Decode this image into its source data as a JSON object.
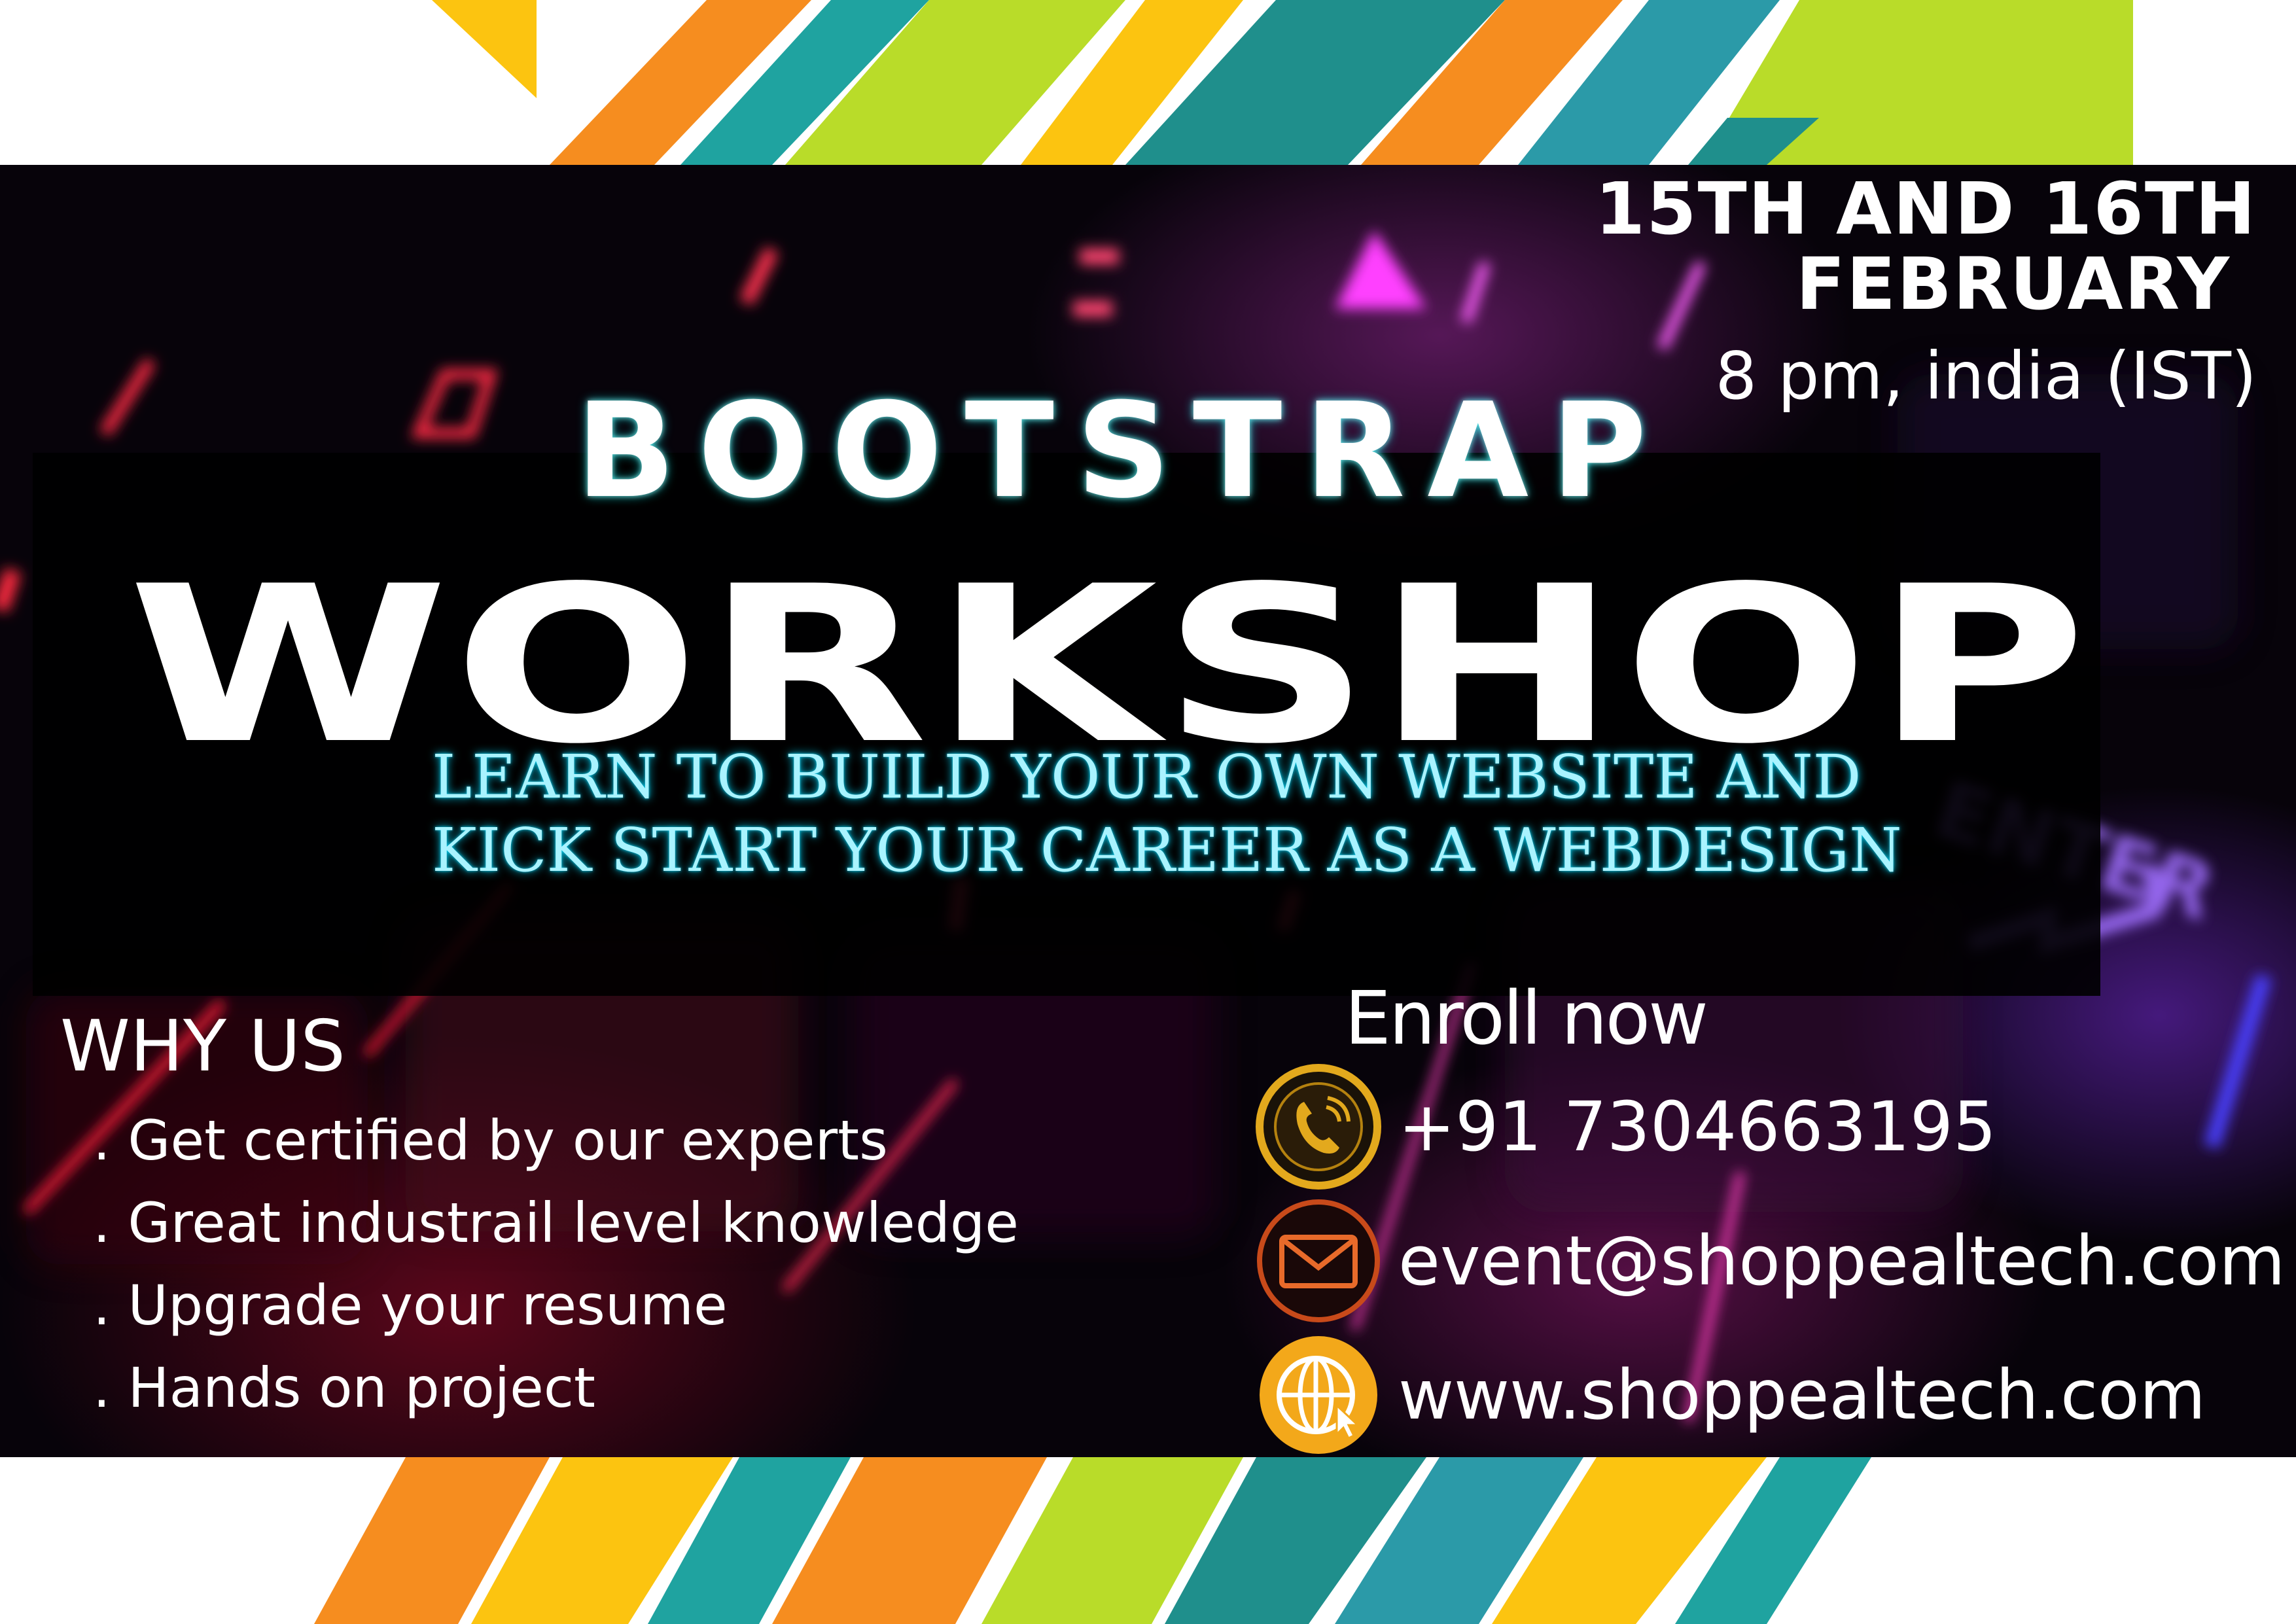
{
  "colors": {
    "panel": "#07030a",
    "tagline": "#a9f3ff",
    "accent_orange": "#f68d1f",
    "accent_yellow": "#fcc410",
    "accent_teal": "#1fa3a0",
    "accent_lime": "#b9dc29",
    "icon_gold": "#e3a91d"
  },
  "event": {
    "date_line1": "15TH AND 16TH",
    "date_line2": "FEBRUARY",
    "time": "8 pm, india (IST)"
  },
  "title": {
    "line1": "BOOTSTRAP",
    "line2": "WORKSHOP"
  },
  "tagline": {
    "line1": "LEARN TO BUILD YOUR OWN WEBSITE AND",
    "line2": "KICK START YOUR CAREER AS A WEBDESIGN"
  },
  "why_us": {
    "title": "WHY US",
    "items": [
      ". Get certified by our experts",
      ". Great industrail level knowledge",
      ". Upgrade your resume",
      ". Hands on project"
    ]
  },
  "contact": {
    "title": "Enroll now",
    "phone": {
      "icon": "phone-icon",
      "text": "+91 7304663195"
    },
    "email": {
      "icon": "mail-icon",
      "text": "event@shoppealtech.com"
    },
    "website": {
      "icon": "globe-icon",
      "text": "www.shoppealtech.com"
    }
  }
}
